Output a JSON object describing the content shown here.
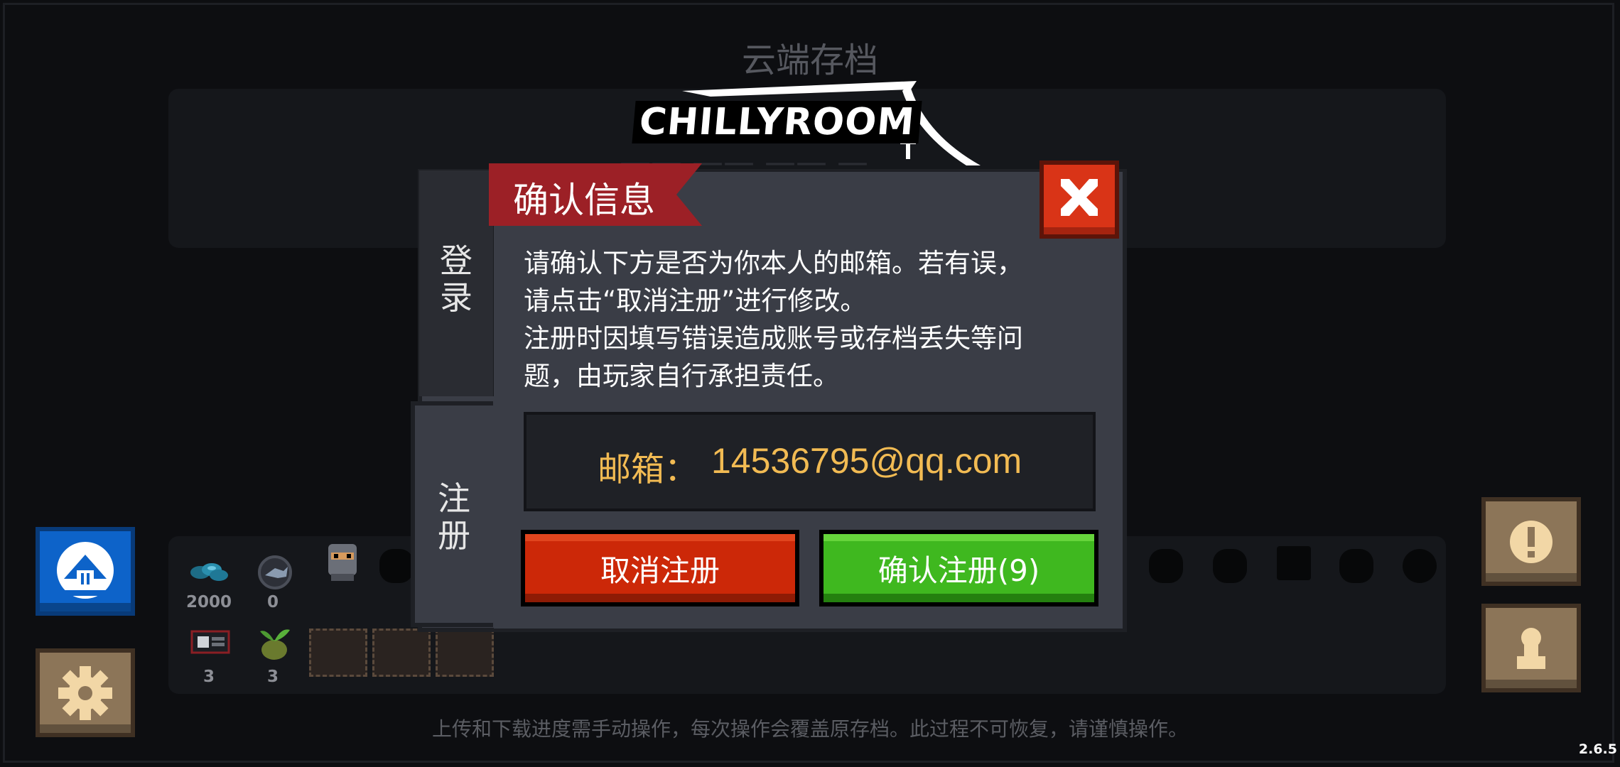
{
  "background": {
    "title": "云端存档",
    "footer_note": "上传和下载进度需手动操作，每次操作会覆盖原存档。此过程不可恢复，请谨慎操作。",
    "version": "2.6.5",
    "inventory": {
      "gems": "2000",
      "fish": "0",
      "card_count": "3",
      "sprout_count": "3"
    }
  },
  "logo": {
    "text": "CHILLYROOM"
  },
  "dialog": {
    "title": "确认信息",
    "tab_login": [
      "登",
      "录"
    ],
    "tab_register": [
      "注",
      "册"
    ],
    "body_lines": [
      "请确认下方是否为你本人的邮箱。若有误，",
      "请点击“取消注册”进行修改。",
      "注册时因填写错误造成账号或存档丢失等问",
      "题，由玩家自行承担责任。"
    ],
    "email_label": "邮箱：",
    "email_value": "14536795@qq.com",
    "cancel_label": "取消注册",
    "confirm_label": "确认注册(9)"
  },
  "colors": {
    "accent_email": "#f2bb53",
    "ribbon": "#9c2026",
    "cancel": "#cc2808",
    "confirm": "#3fb81f",
    "close": "#d93417"
  }
}
